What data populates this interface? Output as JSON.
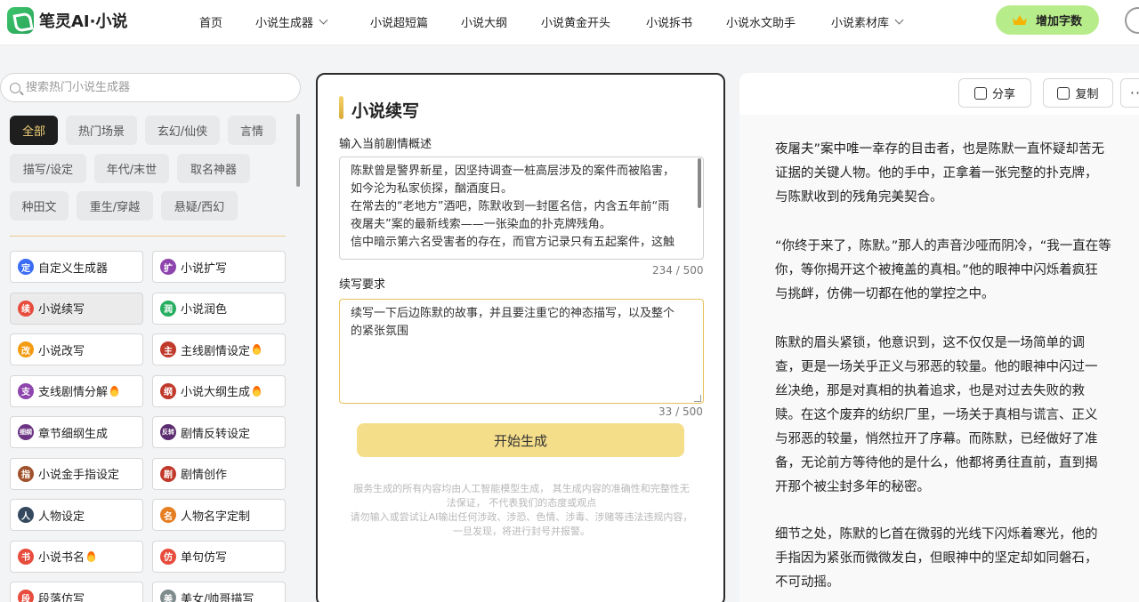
{
  "header": {
    "brand": "笔灵AI·小说",
    "nav": [
      {
        "label": "首页",
        "dropdown": false
      },
      {
        "label": "小说生成器",
        "dropdown": true
      },
      {
        "label": "小说超短篇",
        "dropdown": false
      },
      {
        "label": "小说大纲",
        "dropdown": false
      },
      {
        "label": "小说黄金开头",
        "dropdown": false
      },
      {
        "label": "小说拆书",
        "dropdown": false
      },
      {
        "label": "小说水文助手",
        "dropdown": false
      },
      {
        "label": "小说素材库",
        "dropdown": true
      }
    ],
    "cta_label": "增加字数",
    "cta_color": "#b7ec8a"
  },
  "sidebar": {
    "search_placeholder": "搜索热门小说生成器",
    "chips": [
      "全部",
      "热门场景",
      "玄幻/仙侠",
      "言情",
      "描写/设定",
      "年代/末世",
      "取名神器",
      "种田文",
      "重生/穿越",
      "悬疑/西幻"
    ],
    "active_chip": 0,
    "tools": [
      {
        "label": "自定义生成器",
        "icon": "定",
        "color": "#3b6cf6",
        "hot": false
      },
      {
        "label": "小说扩写",
        "icon": "扩",
        "color": "#8e44ad",
        "hot": false
      },
      {
        "label": "小说续写",
        "icon": "续",
        "color": "#e74c3c",
        "hot": false,
        "selected": true
      },
      {
        "label": "小说润色",
        "icon": "润",
        "color": "#27ae60",
        "hot": false
      },
      {
        "label": "小说改写",
        "icon": "改",
        "color": "#f39c12",
        "hot": false
      },
      {
        "label": "主线剧情设定",
        "icon": "主",
        "color": "#c0392b",
        "hot": true
      },
      {
        "label": "支线剧情分解",
        "icon": "支",
        "color": "#8e44ad",
        "hot": true
      },
      {
        "label": "小说大纲生成",
        "icon": "纲",
        "color": "#c0392b",
        "hot": true
      },
      {
        "label": "章节细纲生成",
        "icon": "细纲",
        "color": "#6c3483",
        "hot": false
      },
      {
        "label": "剧情反转设定",
        "icon": "反转",
        "color": "#5b2c6f",
        "hot": false
      },
      {
        "label": "小说金手指设定",
        "icon": "指",
        "color": "#a0522d",
        "hot": false
      },
      {
        "label": "剧情创作",
        "icon": "剧",
        "color": "#c0392b",
        "hot": false
      },
      {
        "label": "人物设定",
        "icon": "人",
        "color": "#34495e",
        "hot": false
      },
      {
        "label": "人物名字定制",
        "icon": "名",
        "color": "#e67e22",
        "hot": false
      },
      {
        "label": "小说书名",
        "icon": "书",
        "color": "#e74c3c",
        "hot": true
      },
      {
        "label": "单句仿写",
        "icon": "仿",
        "color": "#e74c3c",
        "hot": false
      },
      {
        "label": "段落仿写",
        "icon": "段",
        "color": "#e74c3c",
        "hot": false
      },
      {
        "label": "美女/帅哥描写",
        "icon": "美",
        "color": "#7f8c8d",
        "hot": false
      }
    ]
  },
  "panel": {
    "title": "小说续写",
    "plot_label": "输入当前剧情概述",
    "plot_lines": [
      "陈默曾是警界新星，因坚持调查一桩高层涉及的案件而被陷害，",
      "如今沦为私家侦探，酗酒度日。",
      "在常去的“老地方”酒吧，陈默收到一封匿名信，内含五年前“雨",
      "夜屠夫”案的最新线索——一张染血的扑克牌残角。",
      "信中暗示第六名受害者的存在，而官方记录只有五起案件，这触"
    ],
    "plot_counter": "234 / 500",
    "req_label": "续写要求",
    "req_lines": [
      "续写一下后边陈默的故事，并且要注重它的神态描写，以及整个",
      "的紧张氛围"
    ],
    "req_counter": "33 / 500",
    "generate_label": "开始生成",
    "disclaimer_lines": [
      "服务生成的所有内容均由人工智能模型生成， 其生成内容的准确性和完整性无",
      "法保证， 不代表我们的态度或观点",
      "请勿输入或尝试让AI输出任何涉政、涉恐、色情、涉毒、涉赌等违法违规内容，",
      "一旦发现，将进行封号并报警。"
    ]
  },
  "output": {
    "share_label": "分享",
    "copy_label": "复制",
    "more_label": "···",
    "paragraphs": [
      [
        "夜屠夫”案中唯一幸存的目击者，也是陈默一直怀疑却苦无",
        "证据的关键人物。他的手中，正拿着一张完整的扑克牌，",
        "与陈默收到的残角完美契合。"
      ],
      [
        "“你终于来了，陈默。”那人的声音沙哑而阴冷，“我一直在等",
        "你，等你揭开这个被掩盖的真相。”他的眼神中闪烁着疯狂",
        "与挑衅，仿佛一切都在他的掌控之中。"
      ],
      [
        "陈默的眉头紧锁，他意识到，这不仅仅是一场简单的调",
        "查，更是一场关乎正义与邪恶的较量。他的眼神中闪过一",
        "丝决绝，那是对真相的执着追求，也是对过去失败的救",
        "赎。在这个废弃的纺织厂里，一场关于真相与谎言、正义",
        "与邪恶的较量，悄然拉开了序幕。而陈默，已经做好了准",
        "备，无论前方等待他的是什么，他都将勇往直前，直到揭",
        "开那个被尘封多年的秘密。"
      ],
      [
        "细节之处，陈默的匕首在微弱的光线下闪烁着寒光，他的",
        "手指因为紧张而微微发白，但眼神中的坚定却如同磐石，",
        "不可动摇。"
      ]
    ]
  }
}
